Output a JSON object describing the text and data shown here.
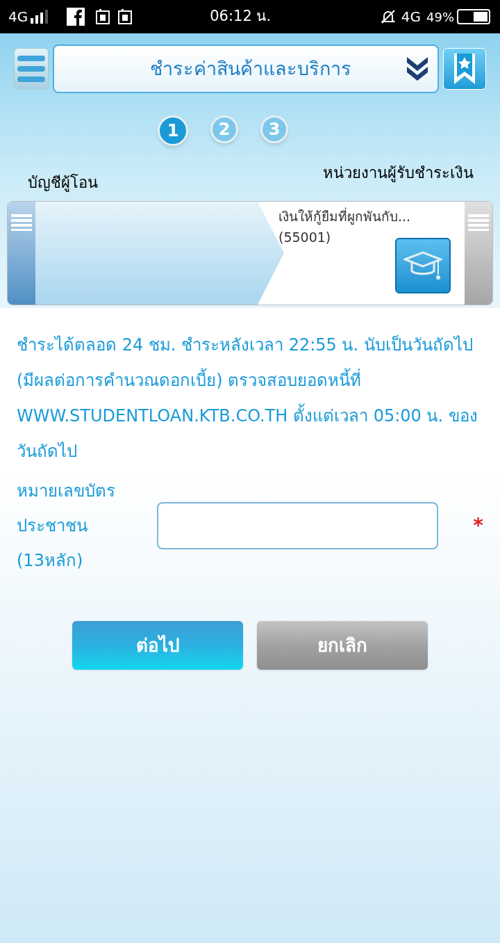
{
  "status_bar": {
    "network_left": "4G",
    "time": "06:12 น.",
    "network_right": "4G",
    "battery": "49%"
  },
  "header": {
    "title": "ชำระค่าสินค้าและบริการ"
  },
  "steps": [
    {
      "label": "1",
      "selected": true
    },
    {
      "label": "2",
      "selected": false
    },
    {
      "label": "3",
      "selected": false
    }
  ],
  "transfer": {
    "from_label": "บัญชีผู้โอน",
    "to_label": "หน่วยงานผู้รับชำระเงิน",
    "payee_name": "เงินให้กู้ยืมที่ผูกพันกับ...",
    "payee_code": "(55001)"
  },
  "notice": "ชำระได้ตลอด 24 ชม. ชำระหลังเวลา 22:55 น. นับเป็นวันถัดไป (มีผลต่อการคำนวณดอกเบี้ย) ตรวจสอบยอดหนี้ที่ WWW.STUDENTLOAN.KTB.CO.TH ตั้งแต่เวลา 05:00 น. ของวันถัดไป",
  "form": {
    "label": "หมายเลขบัตรประชาชน (13หลัก)",
    "required_mark": "*"
  },
  "buttons": [
    {
      "kind": "primary",
      "label": "ต่อไป"
    },
    {
      "kind": "secondary",
      "label": "ยกเลิก"
    }
  ]
}
